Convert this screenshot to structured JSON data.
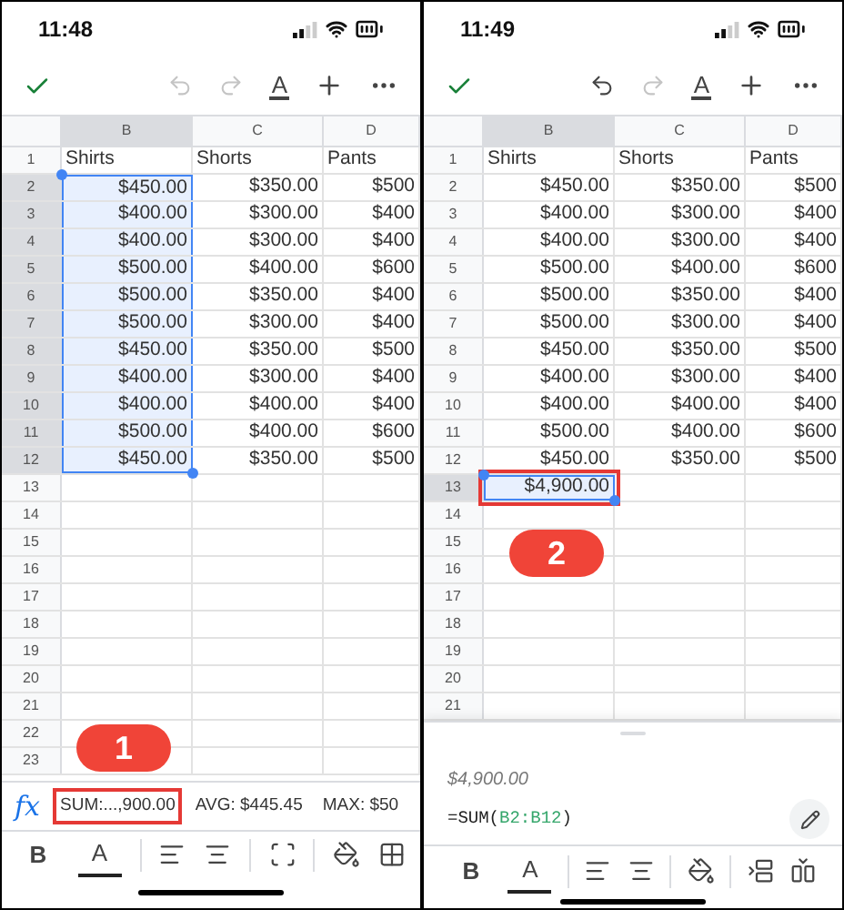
{
  "panels": [
    {
      "time": "11:48",
      "toolbar": {
        "undo_enabled": false,
        "redo_enabled": false,
        "format_label": "A"
      },
      "columns": [
        {
          "label": "B",
          "selected": true
        },
        {
          "label": "C",
          "selected": false
        },
        {
          "label": "D",
          "selected": false
        }
      ],
      "rows": [
        {
          "number": "1",
          "selected": false,
          "kind": "label",
          "cells": [
            {
              "text": "Shirts",
              "selected": false
            },
            {
              "text": "Shorts",
              "selected": false
            },
            {
              "text": "Pants",
              "selected": false
            }
          ]
        },
        {
          "number": "2",
          "selected": true,
          "kind": "value",
          "cells": [
            {
              "text": "$450.00",
              "selected": true
            },
            {
              "text": "$350.00",
              "selected": false
            },
            {
              "text": "$500",
              "selected": false
            }
          ]
        },
        {
          "number": "3",
          "selected": true,
          "kind": "value",
          "cells": [
            {
              "text": "$400.00",
              "selected": true
            },
            {
              "text": "$300.00",
              "selected": false
            },
            {
              "text": "$400",
              "selected": false
            }
          ]
        },
        {
          "number": "4",
          "selected": true,
          "kind": "value",
          "cells": [
            {
              "text": "$400.00",
              "selected": true
            },
            {
              "text": "$300.00",
              "selected": false
            },
            {
              "text": "$400",
              "selected": false
            }
          ]
        },
        {
          "number": "5",
          "selected": true,
          "kind": "value",
          "cells": [
            {
              "text": "$500.00",
              "selected": true
            },
            {
              "text": "$400.00",
              "selected": false
            },
            {
              "text": "$600",
              "selected": false
            }
          ]
        },
        {
          "number": "6",
          "selected": true,
          "kind": "value",
          "cells": [
            {
              "text": "$500.00",
              "selected": true
            },
            {
              "text": "$350.00",
              "selected": false
            },
            {
              "text": "$400",
              "selected": false
            }
          ]
        },
        {
          "number": "7",
          "selected": true,
          "kind": "value",
          "cells": [
            {
              "text": "$500.00",
              "selected": true
            },
            {
              "text": "$300.00",
              "selected": false
            },
            {
              "text": "$400",
              "selected": false
            }
          ]
        },
        {
          "number": "8",
          "selected": true,
          "kind": "value",
          "cells": [
            {
              "text": "$450.00",
              "selected": true
            },
            {
              "text": "$350.00",
              "selected": false
            },
            {
              "text": "$500",
              "selected": false
            }
          ]
        },
        {
          "number": "9",
          "selected": true,
          "kind": "value",
          "cells": [
            {
              "text": "$400.00",
              "selected": true
            },
            {
              "text": "$300.00",
              "selected": false
            },
            {
              "text": "$400",
              "selected": false
            }
          ]
        },
        {
          "number": "10",
          "selected": true,
          "kind": "value",
          "cells": [
            {
              "text": "$400.00",
              "selected": true
            },
            {
              "text": "$400.00",
              "selected": false
            },
            {
              "text": "$400",
              "selected": false
            }
          ]
        },
        {
          "number": "11",
          "selected": true,
          "kind": "value",
          "cells": [
            {
              "text": "$500.00",
              "selected": true
            },
            {
              "text": "$400.00",
              "selected": false
            },
            {
              "text": "$600",
              "selected": false
            }
          ]
        },
        {
          "number": "12",
          "selected": true,
          "kind": "value",
          "cells": [
            {
              "text": "$450.00",
              "selected": true
            },
            {
              "text": "$350.00",
              "selected": false
            },
            {
              "text": "$500",
              "selected": false
            }
          ]
        },
        {
          "number": "13",
          "selected": false
        },
        {
          "number": "14",
          "selected": false
        },
        {
          "number": "15",
          "selected": false
        },
        {
          "number": "16",
          "selected": false
        },
        {
          "number": "17",
          "selected": false
        },
        {
          "number": "18",
          "selected": false
        },
        {
          "number": "19",
          "selected": false
        },
        {
          "number": "20",
          "selected": false
        },
        {
          "number": "21",
          "selected": false
        },
        {
          "number": "22",
          "selected": false
        },
        {
          "number": "23",
          "selected": false
        }
      ],
      "callout": "1",
      "formula_bar": {
        "fx_label": "fx",
        "stats": [
          {
            "text": "SUM:...,900.00",
            "highlighted": true
          },
          {
            "text": "AVG: $445.45",
            "highlighted": false
          },
          {
            "text": "MAX: $50",
            "highlighted": false
          }
        ]
      },
      "format_bar": [
        {
          "kind": "bold",
          "label": "B"
        },
        {
          "kind": "text-color",
          "label": "A"
        },
        {
          "kind": "align-left",
          "divider_before": true
        },
        {
          "kind": "align-center"
        },
        {
          "kind": "merge",
          "divider_before": true
        },
        {
          "kind": "fill",
          "divider_before": true
        },
        {
          "kind": "borders"
        }
      ]
    },
    {
      "time": "11:49",
      "toolbar": {
        "undo_enabled": true,
        "redo_enabled": false,
        "format_label": "A"
      },
      "columns": [
        {
          "label": "B",
          "selected": true
        },
        {
          "label": "C",
          "selected": false
        },
        {
          "label": "D",
          "selected": false
        }
      ],
      "rows": [
        {
          "number": "1",
          "selected": false,
          "kind": "label",
          "cells": [
            {
              "text": "Shirts",
              "selected": false
            },
            {
              "text": "Shorts",
              "selected": false
            },
            {
              "text": "Pants",
              "selected": false
            }
          ]
        },
        {
          "number": "2",
          "selected": false,
          "kind": "value",
          "cells": [
            {
              "text": "$450.00",
              "selected": false
            },
            {
              "text": "$350.00",
              "selected": false
            },
            {
              "text": "$500",
              "selected": false
            }
          ]
        },
        {
          "number": "3",
          "selected": false,
          "kind": "value",
          "cells": [
            {
              "text": "$400.00",
              "selected": false
            },
            {
              "text": "$300.00",
              "selected": false
            },
            {
              "text": "$400",
              "selected": false
            }
          ]
        },
        {
          "number": "4",
          "selected": false,
          "kind": "value",
          "cells": [
            {
              "text": "$400.00",
              "selected": false
            },
            {
              "text": "$300.00",
              "selected": false
            },
            {
              "text": "$400",
              "selected": false
            }
          ]
        },
        {
          "number": "5",
          "selected": false,
          "kind": "value",
          "cells": [
            {
              "text": "$500.00",
              "selected": false
            },
            {
              "text": "$400.00",
              "selected": false
            },
            {
              "text": "$600",
              "selected": false
            }
          ]
        },
        {
          "number": "6",
          "selected": false,
          "kind": "value",
          "cells": [
            {
              "text": "$500.00",
              "selected": false
            },
            {
              "text": "$350.00",
              "selected": false
            },
            {
              "text": "$400",
              "selected": false
            }
          ]
        },
        {
          "number": "7",
          "selected": false,
          "kind": "value",
          "cells": [
            {
              "text": "$500.00",
              "selected": false
            },
            {
              "text": "$300.00",
              "selected": false
            },
            {
              "text": "$400",
              "selected": false
            }
          ]
        },
        {
          "number": "8",
          "selected": false,
          "kind": "value",
          "cells": [
            {
              "text": "$450.00",
              "selected": false
            },
            {
              "text": "$350.00",
              "selected": false
            },
            {
              "text": "$500",
              "selected": false
            }
          ]
        },
        {
          "number": "9",
          "selected": false,
          "kind": "value",
          "cells": [
            {
              "text": "$400.00",
              "selected": false
            },
            {
              "text": "$300.00",
              "selected": false
            },
            {
              "text": "$400",
              "selected": false
            }
          ]
        },
        {
          "number": "10",
          "selected": false,
          "kind": "value",
          "cells": [
            {
              "text": "$400.00",
              "selected": false
            },
            {
              "text": "$400.00",
              "selected": false
            },
            {
              "text": "$400",
              "selected": false
            }
          ]
        },
        {
          "number": "11",
          "selected": false,
          "kind": "value",
          "cells": [
            {
              "text": "$500.00",
              "selected": false
            },
            {
              "text": "$400.00",
              "selected": false
            },
            {
              "text": "$600",
              "selected": false
            }
          ]
        },
        {
          "number": "12",
          "selected": false,
          "kind": "value",
          "cells": [
            {
              "text": "$450.00",
              "selected": false
            },
            {
              "text": "$350.00",
              "selected": false
            },
            {
              "text": "$500",
              "selected": false
            }
          ]
        },
        {
          "number": "13",
          "selected": true,
          "kind": "value",
          "cells": [
            {
              "text": "$4,900.00",
              "selected": true,
              "highlighted": true
            }
          ]
        },
        {
          "number": "14",
          "selected": false
        },
        {
          "number": "15",
          "selected": false
        },
        {
          "number": "16",
          "selected": false
        },
        {
          "number": "17",
          "selected": false
        },
        {
          "number": "18",
          "selected": false
        },
        {
          "number": "19",
          "selected": false
        },
        {
          "number": "20",
          "selected": false
        },
        {
          "number": "21",
          "selected": false
        }
      ],
      "callout": "2",
      "cell_sheet": {
        "value": "$4,900.00",
        "formula": [
          {
            "text": "=SUM(",
            "kind": "plain"
          },
          {
            "text": "B2:B12",
            "kind": "range"
          },
          {
            "text": ")",
            "kind": "plain"
          }
        ]
      },
      "format_bar": [
        {
          "kind": "bold",
          "label": "B"
        },
        {
          "kind": "text-color",
          "label": "A"
        },
        {
          "kind": "align-left",
          "divider_before": true
        },
        {
          "kind": "align-center"
        },
        {
          "kind": "fill",
          "divider_before": true
        },
        {
          "kind": "insert-row",
          "divider_before": true
        },
        {
          "kind": "insert-column"
        }
      ]
    }
  ]
}
